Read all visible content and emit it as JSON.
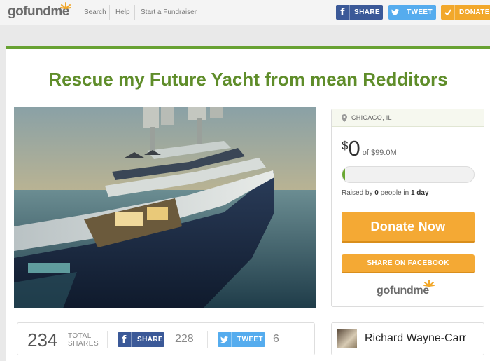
{
  "nav": {
    "logo": {
      "go": "go",
      "fund": "fund",
      "me": "me"
    },
    "links": [
      "Search",
      "Help",
      "Start a Fundraiser"
    ],
    "share_fb": "SHARE",
    "share_tw": "TWEET",
    "donate": "DONATE"
  },
  "campaign": {
    "title": "Rescue my Future Yacht from mean Redditors",
    "location": "CHICAGO, IL",
    "currency": "$",
    "raised_amount": "0",
    "goal_text": "of $99.0M",
    "progress_fraction": 0.02,
    "raised_prefix": "Raised by ",
    "people": "0",
    "people_suffix": " people in ",
    "days": "1 day",
    "donate_now": "Donate Now",
    "share_facebook": "SHARE ON FACEBOOK",
    "panel_logo": "gofundme"
  },
  "shares": {
    "total": "234",
    "total_label_1": "TOTAL",
    "total_label_2": "SHARES",
    "fb_label": "SHARE",
    "fb_count": "228",
    "tw_label": "TWEET",
    "tw_count": "6"
  },
  "organizer": {
    "name": "Richard Wayne-Carr"
  },
  "colors": {
    "green": "#68a233",
    "orange": "#f4a934",
    "facebook": "#3b5998",
    "twitter": "#55acee"
  }
}
